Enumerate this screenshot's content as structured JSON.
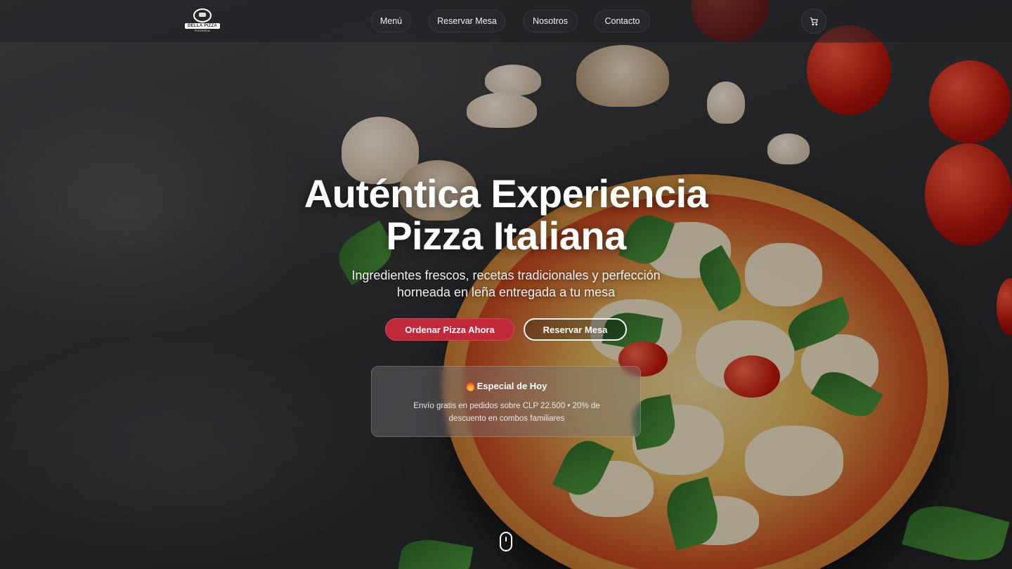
{
  "brand": {
    "logo_text": "DELLA PIZZA",
    "logo_sub": "PIZZERIA"
  },
  "nav": {
    "items": [
      {
        "label": "Menú"
      },
      {
        "label": "Reservar Mesa"
      },
      {
        "label": "Nosotros"
      },
      {
        "label": "Contacto"
      }
    ],
    "cart_icon": "cart-icon"
  },
  "hero": {
    "title_line1": "Auténtica Experiencia",
    "title_line2": "Pizza Italiana",
    "subtitle": "Ingredientes frescos, recetas tradicionales y perfección horneada en leña entregada a tu mesa",
    "primary_cta": "Ordenar Pizza Ahora",
    "secondary_cta": "Reservar Mesa"
  },
  "special": {
    "icon": "fire-icon",
    "title": "Especial de Hoy",
    "text": "Envío gratis en pedidos sobre CLP 22.500 • 20% de descuento en combos familiares"
  },
  "scroll_indicator": "mouse-scroll-icon",
  "colors": {
    "accent": "#c1283a",
    "text": "#ffffff",
    "nav_bg": "#1e1e20"
  }
}
